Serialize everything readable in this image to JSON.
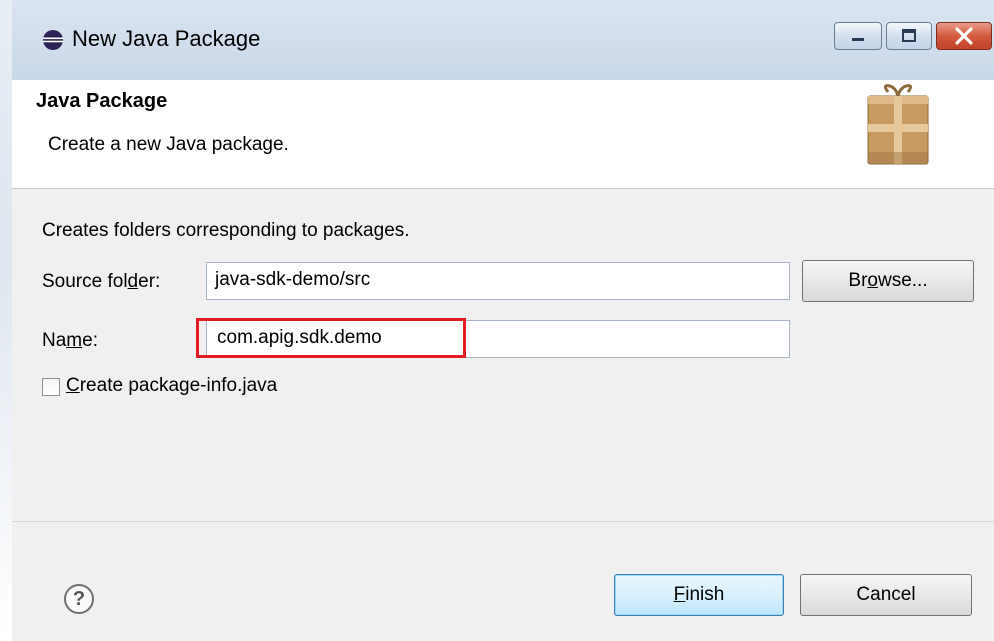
{
  "window": {
    "title": "New Java Package",
    "icon": "eclipse-icon",
    "controls": {
      "minimize": "minimize-icon",
      "maximize": "maximize-icon",
      "close": "close-icon"
    }
  },
  "header": {
    "title": "Java Package",
    "description": "Create a new Java package.",
    "icon": "package-icon"
  },
  "form": {
    "intro": "Creates folders corresponding to packages.",
    "source_folder": {
      "label_pre": "Source fol",
      "label_mnemonic": "d",
      "label_post": "er:",
      "value": "java-sdk-demo/src"
    },
    "browse_button": {
      "pre": "Br",
      "mnemonic": "o",
      "post": "wse..."
    },
    "name": {
      "label_pre": "Na",
      "label_mnemonic": "m",
      "label_post": "e:",
      "value": "com.apig.sdk.demo"
    },
    "create_package_info": {
      "mnemonic": "C",
      "label_post": "reate package-info.java",
      "checked": false
    }
  },
  "footer": {
    "help": "?",
    "finish": {
      "mnemonic": "F",
      "post": "inish"
    },
    "cancel": "Cancel"
  },
  "colors": {
    "highlight": "#e31c23",
    "titlebar": "#c9d7e8"
  }
}
